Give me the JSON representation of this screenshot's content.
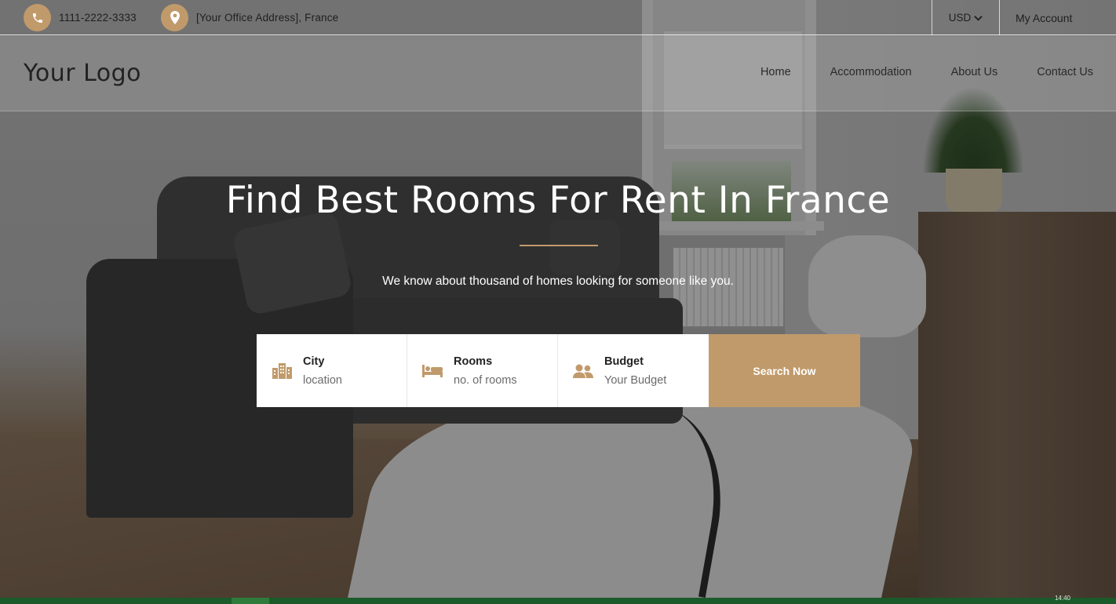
{
  "topbar": {
    "phone": "1111-2222-3333",
    "address": "[Your Office Address], France",
    "currency": "USD",
    "account_label": "My Account"
  },
  "header": {
    "logo": "Your Logo",
    "nav": [
      {
        "label": "Home"
      },
      {
        "label": "Accommodation"
      },
      {
        "label": "About Us"
      },
      {
        "label": "Contact Us"
      }
    ]
  },
  "hero": {
    "title": "Find Best Rooms For Rent In France",
    "subtitle": "We know about thousand of homes looking for someone like you."
  },
  "search": {
    "fields": [
      {
        "label": "City",
        "placeholder": "location",
        "icon": "building-icon"
      },
      {
        "label": "Rooms",
        "placeholder": "no. of rooms",
        "icon": "bed-icon"
      },
      {
        "label": "Budget",
        "placeholder": "Your Budget",
        "icon": "users-icon"
      }
    ],
    "button": "Search Now"
  },
  "taskbar": {
    "time": "14:40"
  },
  "colors": {
    "accent": "#c19a6b",
    "taskbar": "#1b5a2a"
  }
}
